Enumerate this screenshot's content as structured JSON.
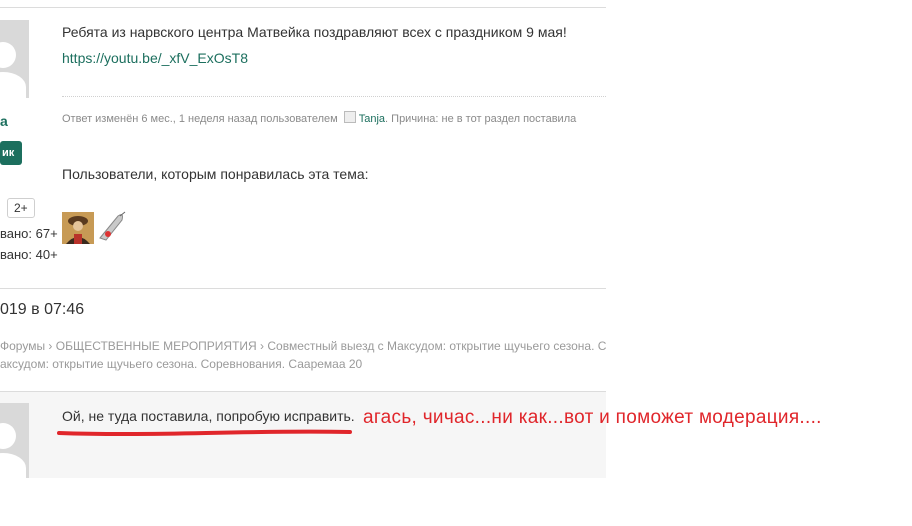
{
  "post": {
    "text": "Ребята из нарвского центра Матвейка поздравляют всех с праздником 9 мая!",
    "link": "https://youtu.be/_xfV_ExOsT8",
    "edit_prefix": "Ответ изменён 6 мес., 1 неделя назад пользователем",
    "edit_user": "Tanja",
    "edit_reason": ". Причина: не в тот раздел поставила",
    "likes_heading": "Пользователи, которым понравилась эта тема:"
  },
  "author": {
    "name_fragment": "a",
    "badge_fragment": "ик",
    "count_bubble": "2+",
    "stat1": "вано: 67+",
    "stat2": "вано: 40+"
  },
  "reply": {
    "date": "019 в 07:46",
    "breadcrumb_line1": "Форумы › ОБЩЕСТВЕННЫЕ МЕРОПРИЯТИЯ › Совместный выезд с Максудом: открытие щучьего сезона. Сорев",
    "breadcrumb_line2": "аксудом: открытие щучьего сезона. Соревнования. Сааремаа 20",
    "text": "Ой, не туда поставила, попробую исправить."
  },
  "annotation": {
    "text": "агась, чичас...ни как...вот и поможет модерация....",
    "color": "#e0262b"
  },
  "colors": {
    "accent": "#1c6f5e",
    "divider": "#dcdcdc"
  }
}
